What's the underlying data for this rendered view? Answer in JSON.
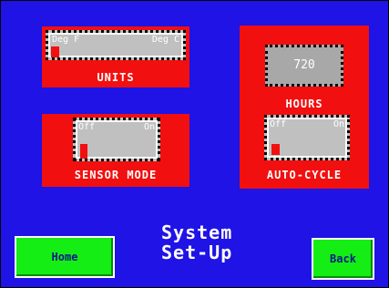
{
  "screen": {
    "title_line1": "System",
    "title_line2": "Set-Up"
  },
  "units": {
    "label": "UNITS",
    "option_left": "Deg F",
    "option_right": "Deg C",
    "selected": "Deg F"
  },
  "sensor_mode": {
    "label": "SENSOR MODE",
    "option_off": "Off",
    "option_on": "On",
    "selected": "Off"
  },
  "hours": {
    "label": "HOURS",
    "value": "720"
  },
  "auto_cycle": {
    "label": "AUTO-CYCLE",
    "option_off": "Off",
    "option_on": "On",
    "selected": "Off"
  },
  "nav": {
    "home_label": "Home",
    "back_label": "Back"
  },
  "colors": {
    "background": "#1f13e6",
    "panel": "#f20f0f",
    "button": "#14ee14"
  }
}
